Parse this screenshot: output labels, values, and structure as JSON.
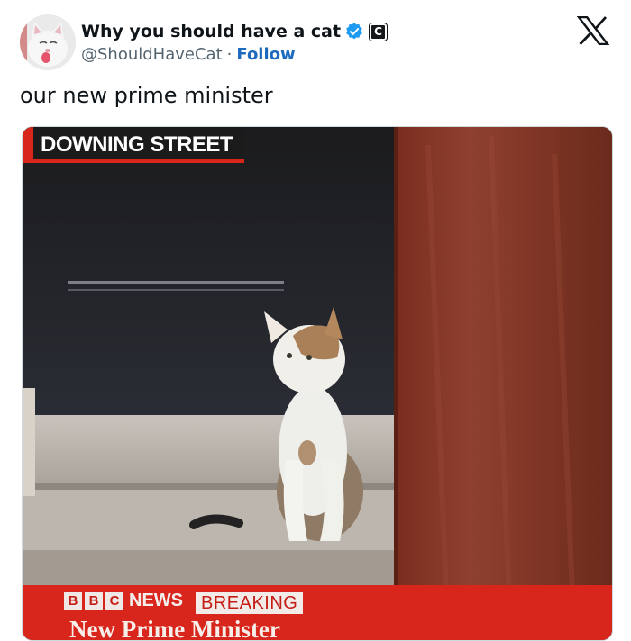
{
  "tweet": {
    "author": {
      "display_name": "Why you should have a cat",
      "handle": "@ShouldHaveCat",
      "separator": "·",
      "follow_label": "Follow",
      "verified_icon": "verified-badge-icon",
      "affiliate_icon": "affiliate-badge-icon",
      "affiliate_letter": "C"
    },
    "platform_icon": "x-logo-icon",
    "text": "our new prime minister",
    "media": {
      "location_label": "DOWNING STREET",
      "broadcaster_letters": [
        "B",
        "B",
        "C"
      ],
      "news_word": "NEWS",
      "breaking_label": "BREAKING",
      "headline": "New Prime Minister"
    }
  },
  "colors": {
    "follow_link": "#1d6bbd",
    "verified_badge": "#1d9bf0",
    "bbc_red": "#d8261c",
    "door_red": "#8a3a2a"
  }
}
